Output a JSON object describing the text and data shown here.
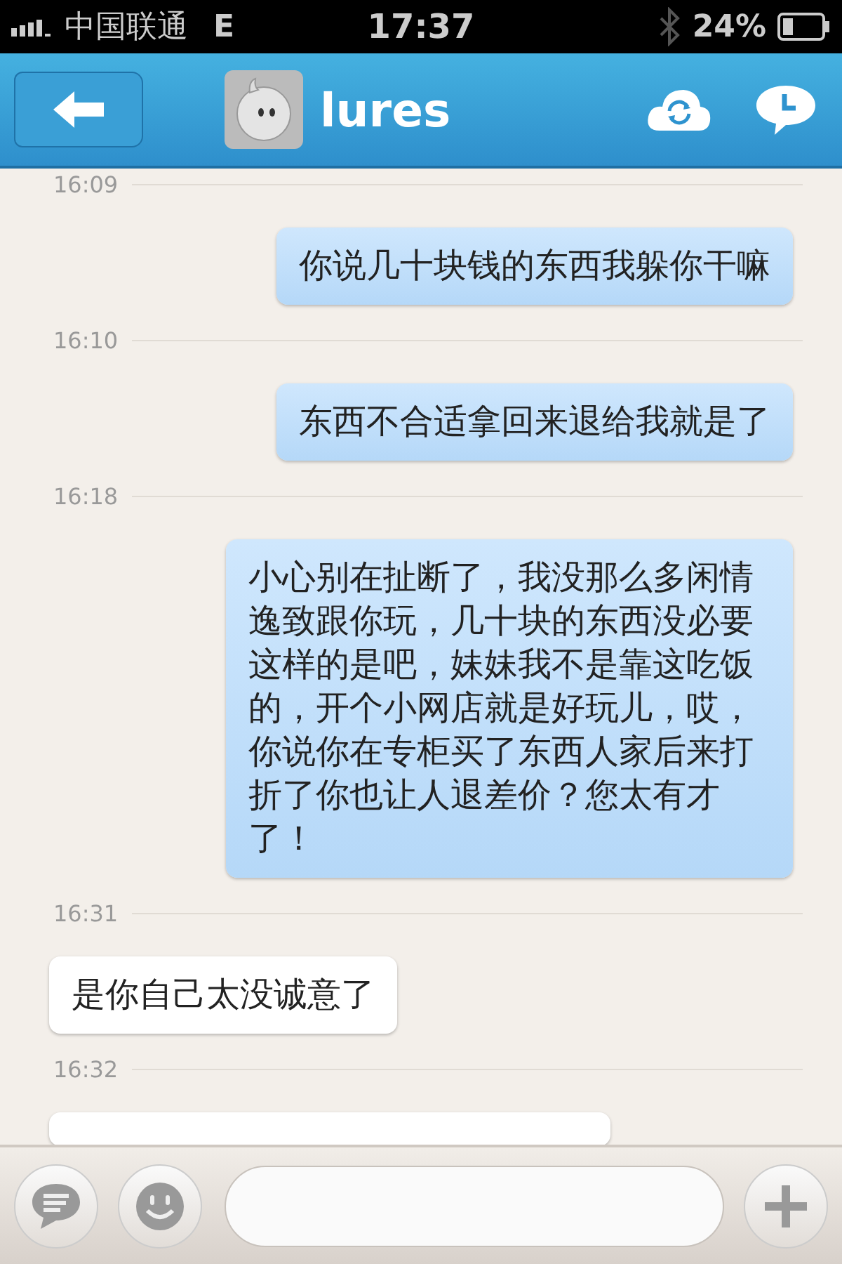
{
  "status_bar": {
    "carrier": "中国联通",
    "network": "E",
    "time": "17:37",
    "battery": "24%"
  },
  "nav": {
    "title": "lures"
  },
  "messages": [
    {
      "kind": "time",
      "text": "16:09"
    },
    {
      "kind": "sent",
      "text": "你说几十块钱的东西我躲你干嘛"
    },
    {
      "kind": "time",
      "text": "16:10"
    },
    {
      "kind": "sent",
      "text": "东西不合适拿回来退给我就是了"
    },
    {
      "kind": "time",
      "text": "16:18"
    },
    {
      "kind": "sent",
      "text": "小心别在扯断了，我没那么多闲情逸致跟你玩，几十块的东西没必要这样的是吧，妹妹我不是靠这吃饭的，开个小网店就是好玩儿，哎，你说你在专柜买了东西人家后来打折了你也让人退差价？您太有才了！"
    },
    {
      "kind": "time",
      "text": "16:31"
    },
    {
      "kind": "received",
      "text": "是你自己太没诚意了"
    },
    {
      "kind": "time",
      "text": "16:32"
    },
    {
      "kind": "received"
    }
  ]
}
